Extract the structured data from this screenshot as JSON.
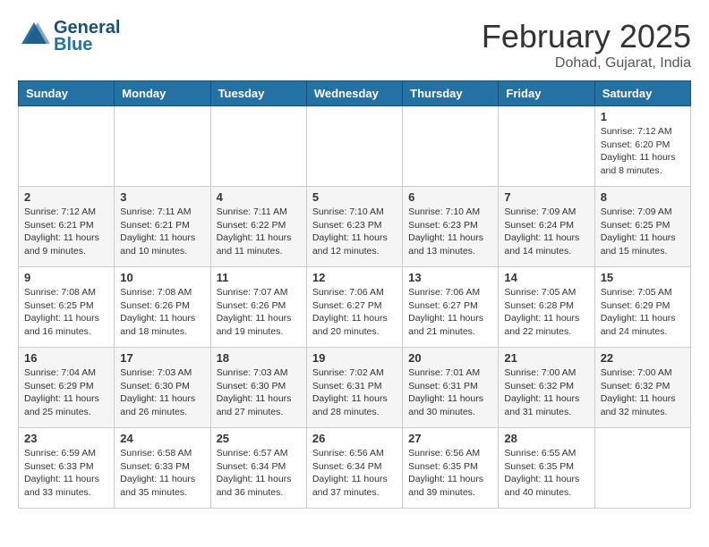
{
  "logo": {
    "line1": "General",
    "line2": "Blue"
  },
  "title": "February 2025",
  "location": "Dohad, Gujarat, India",
  "days_of_week": [
    "Sunday",
    "Monday",
    "Tuesday",
    "Wednesday",
    "Thursday",
    "Friday",
    "Saturday"
  ],
  "weeks": [
    [
      {
        "day": "",
        "info": ""
      },
      {
        "day": "",
        "info": ""
      },
      {
        "day": "",
        "info": ""
      },
      {
        "day": "",
        "info": ""
      },
      {
        "day": "",
        "info": ""
      },
      {
        "day": "",
        "info": ""
      },
      {
        "day": "1",
        "info": "Sunrise: 7:12 AM\nSunset: 6:20 PM\nDaylight: 11 hours and 8 minutes."
      }
    ],
    [
      {
        "day": "2",
        "info": "Sunrise: 7:12 AM\nSunset: 6:21 PM\nDaylight: 11 hours and 9 minutes."
      },
      {
        "day": "3",
        "info": "Sunrise: 7:11 AM\nSunset: 6:21 PM\nDaylight: 11 hours and 10 minutes."
      },
      {
        "day": "4",
        "info": "Sunrise: 7:11 AM\nSunset: 6:22 PM\nDaylight: 11 hours and 11 minutes."
      },
      {
        "day": "5",
        "info": "Sunrise: 7:10 AM\nSunset: 6:23 PM\nDaylight: 11 hours and 12 minutes."
      },
      {
        "day": "6",
        "info": "Sunrise: 7:10 AM\nSunset: 6:23 PM\nDaylight: 11 hours and 13 minutes."
      },
      {
        "day": "7",
        "info": "Sunrise: 7:09 AM\nSunset: 6:24 PM\nDaylight: 11 hours and 14 minutes."
      },
      {
        "day": "8",
        "info": "Sunrise: 7:09 AM\nSunset: 6:25 PM\nDaylight: 11 hours and 15 minutes."
      }
    ],
    [
      {
        "day": "9",
        "info": "Sunrise: 7:08 AM\nSunset: 6:25 PM\nDaylight: 11 hours and 16 minutes."
      },
      {
        "day": "10",
        "info": "Sunrise: 7:08 AM\nSunset: 6:26 PM\nDaylight: 11 hours and 18 minutes."
      },
      {
        "day": "11",
        "info": "Sunrise: 7:07 AM\nSunset: 6:26 PM\nDaylight: 11 hours and 19 minutes."
      },
      {
        "day": "12",
        "info": "Sunrise: 7:06 AM\nSunset: 6:27 PM\nDaylight: 11 hours and 20 minutes."
      },
      {
        "day": "13",
        "info": "Sunrise: 7:06 AM\nSunset: 6:27 PM\nDaylight: 11 hours and 21 minutes."
      },
      {
        "day": "14",
        "info": "Sunrise: 7:05 AM\nSunset: 6:28 PM\nDaylight: 11 hours and 22 minutes."
      },
      {
        "day": "15",
        "info": "Sunrise: 7:05 AM\nSunset: 6:29 PM\nDaylight: 11 hours and 24 minutes."
      }
    ],
    [
      {
        "day": "16",
        "info": "Sunrise: 7:04 AM\nSunset: 6:29 PM\nDaylight: 11 hours and 25 minutes."
      },
      {
        "day": "17",
        "info": "Sunrise: 7:03 AM\nSunset: 6:30 PM\nDaylight: 11 hours and 26 minutes."
      },
      {
        "day": "18",
        "info": "Sunrise: 7:03 AM\nSunset: 6:30 PM\nDaylight: 11 hours and 27 minutes."
      },
      {
        "day": "19",
        "info": "Sunrise: 7:02 AM\nSunset: 6:31 PM\nDaylight: 11 hours and 28 minutes."
      },
      {
        "day": "20",
        "info": "Sunrise: 7:01 AM\nSunset: 6:31 PM\nDaylight: 11 hours and 30 minutes."
      },
      {
        "day": "21",
        "info": "Sunrise: 7:00 AM\nSunset: 6:32 PM\nDaylight: 11 hours and 31 minutes."
      },
      {
        "day": "22",
        "info": "Sunrise: 7:00 AM\nSunset: 6:32 PM\nDaylight: 11 hours and 32 minutes."
      }
    ],
    [
      {
        "day": "23",
        "info": "Sunrise: 6:59 AM\nSunset: 6:33 PM\nDaylight: 11 hours and 33 minutes."
      },
      {
        "day": "24",
        "info": "Sunrise: 6:58 AM\nSunset: 6:33 PM\nDaylight: 11 hours and 35 minutes."
      },
      {
        "day": "25",
        "info": "Sunrise: 6:57 AM\nSunset: 6:34 PM\nDaylight: 11 hours and 36 minutes."
      },
      {
        "day": "26",
        "info": "Sunrise: 6:56 AM\nSunset: 6:34 PM\nDaylight: 11 hours and 37 minutes."
      },
      {
        "day": "27",
        "info": "Sunrise: 6:56 AM\nSunset: 6:35 PM\nDaylight: 11 hours and 39 minutes."
      },
      {
        "day": "28",
        "info": "Sunrise: 6:55 AM\nSunset: 6:35 PM\nDaylight: 11 hours and 40 minutes."
      },
      {
        "day": "",
        "info": ""
      }
    ]
  ]
}
